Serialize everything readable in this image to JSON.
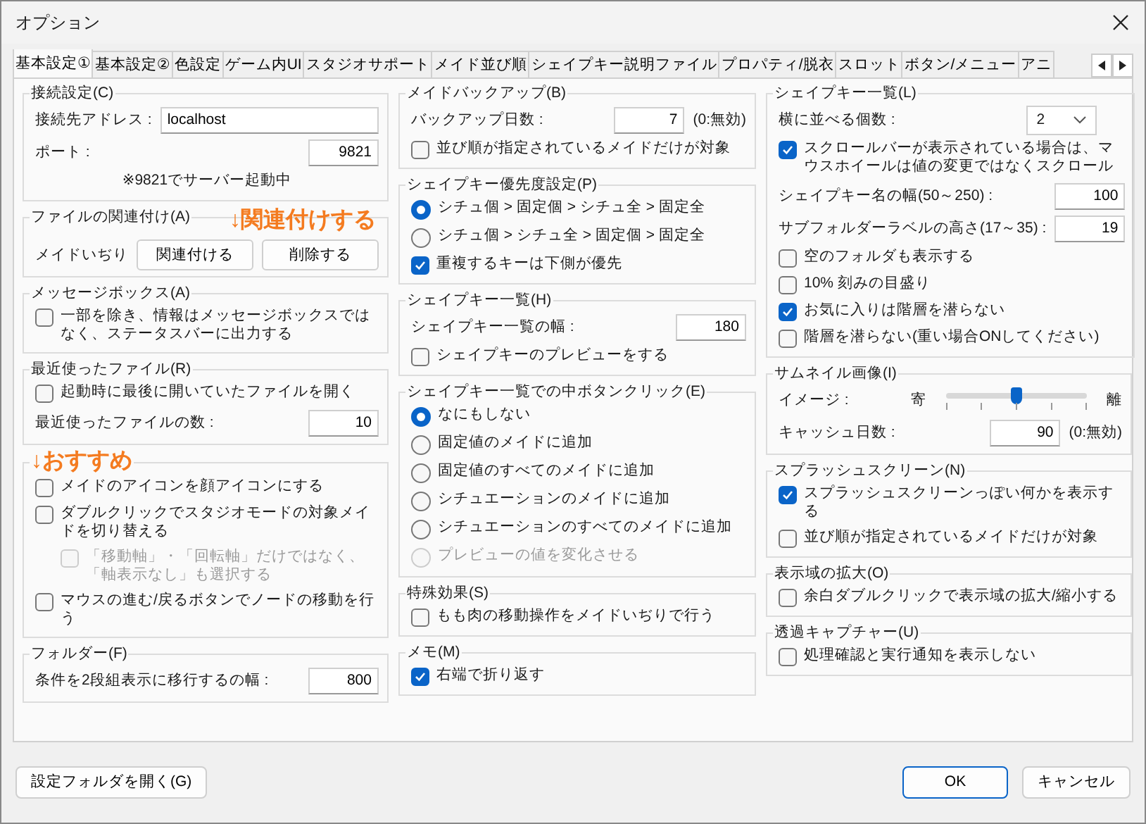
{
  "window": {
    "title": "オプション"
  },
  "tabs": [
    {
      "label": "基本設定①",
      "selected": true
    },
    {
      "label": "基本設定②",
      "selected": false
    },
    {
      "label": "色設定",
      "selected": false
    },
    {
      "label": "ゲーム内UI",
      "selected": false
    },
    {
      "label": "スタジオサポート",
      "selected": false
    },
    {
      "label": "メイド並び順",
      "selected": false
    },
    {
      "label": "シェイプキー説明ファイル",
      "selected": false
    },
    {
      "label": "プロパティ/脱衣",
      "selected": false
    },
    {
      "label": "スロット",
      "selected": false
    },
    {
      "label": "ボタン/メニュー",
      "selected": false
    },
    {
      "label": "アニ",
      "selected": false
    }
  ],
  "columns": [
    {
      "groups": [
        {
          "title": "接続設定(C)",
          "items": [
            {
              "kind": "text-field",
              "label": "接続先アドレス :",
              "value": "localhost"
            },
            {
              "kind": "number-field",
              "label": "ポート :",
              "value": "9821"
            },
            {
              "kind": "note",
              "text": "※9821でサーバー起動中"
            }
          ]
        },
        {
          "title": "ファイルの関連付け(A)",
          "annotation": "↓関連付けする",
          "items": [
            {
              "kind": "buttons",
              "label": "メイドいぢり",
              "buttons": [
                "関連付ける",
                "削除する"
              ]
            }
          ]
        },
        {
          "title": "メッセージボックス(A)",
          "items": [
            {
              "kind": "checkbox",
              "label": "一部を除き、情報はメッセージボックスではなく、ステータスバーに出力する",
              "checked": false,
              "disabled": false
            }
          ]
        },
        {
          "title": "最近使ったファイル(R)",
          "items": [
            {
              "kind": "checkbox",
              "label": "起動時に最後に開いていたファイルを開く",
              "checked": false,
              "disabled": false
            },
            {
              "kind": "number-field",
              "label": "最近使ったファイルの数 :",
              "value": "10"
            }
          ]
        },
        {
          "annotation": "↓おすすめ",
          "items": [
            {
              "kind": "checkbox",
              "label": "メイドのアイコンを顔アイコンにする",
              "checked": false,
              "disabled": false
            },
            {
              "kind": "checkbox",
              "label": "ダブルクリックでスタジオモードの対象メイドを切り替える",
              "checked": false,
              "disabled": false,
              "children": [
                {
                  "kind": "checkbox",
                  "label": "「移動軸」・「回転軸」だけではなく、「軸表示なし」も選択する",
                  "checked": false,
                  "disabled": true
                }
              ]
            },
            {
              "kind": "checkbox",
              "label": "マウスの進む/戻るボタンでノードの移動を行う",
              "checked": false,
              "disabled": false
            }
          ]
        },
        {
          "title": "フォルダー(F)",
          "items": [
            {
              "kind": "number-field",
              "label": "条件を2段組表示に移行するの幅 :",
              "value": "800"
            }
          ]
        }
      ]
    },
    {
      "groups": [
        {
          "title": "メイドバックアップ(B)",
          "items": [
            {
              "kind": "number-field",
              "label": "バックアップ日数 :",
              "value": "7",
              "suffix": "(0:無効)"
            },
            {
              "kind": "checkbox",
              "label": "並び順が指定されているメイドだけが対象",
              "checked": false,
              "disabled": false
            }
          ]
        },
        {
          "title": "シェイプキー優先度設定(P)",
          "items": [
            {
              "kind": "radio",
              "label": "シチュ個 > 固定個 > シチュ全 > 固定全",
              "selected": true,
              "disabled": false
            },
            {
              "kind": "radio",
              "label": "シチュ個 > シチュ全 > 固定個 > 固定全",
              "selected": false,
              "disabled": false
            },
            {
              "kind": "checkbox",
              "label": "重複するキーは下側が優先",
              "checked": true,
              "disabled": false
            }
          ]
        },
        {
          "title": "シェイプキー一覧(H)",
          "items": [
            {
              "kind": "number-field",
              "label": "シェイプキー一覧の幅 :",
              "value": "180"
            },
            {
              "kind": "checkbox",
              "label": "シェイプキーのプレビューをする",
              "checked": false,
              "disabled": false
            }
          ]
        },
        {
          "title": "シェイプキー一覧での中ボタンクリック(E)",
          "items": [
            {
              "kind": "radio",
              "label": "なにもしない",
              "selected": true,
              "disabled": false
            },
            {
              "kind": "radio",
              "label": "固定値のメイドに追加",
              "selected": false,
              "disabled": false
            },
            {
              "kind": "radio",
              "label": "固定値のすべてのメイドに追加",
              "selected": false,
              "disabled": false
            },
            {
              "kind": "radio",
              "label": "シチュエーションのメイドに追加",
              "selected": false,
              "disabled": false
            },
            {
              "kind": "radio",
              "label": "シチュエーションのすべてのメイドに追加",
              "selected": false,
              "disabled": false
            },
            {
              "kind": "radio",
              "label": "プレビューの値を変化させる",
              "selected": false,
              "disabled": true
            }
          ]
        },
        {
          "title": "特殊効果(S)",
          "items": [
            {
              "kind": "checkbox",
              "label": "もも肉の移動操作をメイドいぢりで行う",
              "checked": false,
              "disabled": false
            }
          ]
        },
        {
          "title": "メモ(M)",
          "items": [
            {
              "kind": "checkbox",
              "label": "右端で折り返す",
              "checked": true,
              "disabled": false
            }
          ]
        }
      ]
    },
    {
      "groups": [
        {
          "title": "シェイプキー一覧(L)",
          "items": [
            {
              "kind": "combo",
              "label": "横に並べる個数 :",
              "value": "2"
            },
            {
              "kind": "checkbox",
              "label": "スクロールバーが表示されている場合は、マウスホイールは値の変更ではなくスクロール",
              "checked": true,
              "disabled": false
            },
            {
              "kind": "number-field",
              "label": "シェイプキー名の幅(50～250) :",
              "value": "100"
            },
            {
              "kind": "number-field",
              "label": "サブフォルダーラベルの高さ(17～35) :",
              "value": "19"
            },
            {
              "kind": "checkbox",
              "label": "空のフォルダも表示する",
              "checked": false,
              "disabled": false
            },
            {
              "kind": "checkbox",
              "label": "10% 刻みの目盛り",
              "checked": false,
              "disabled": false
            },
            {
              "kind": "checkbox",
              "label": "お気に入りは階層を潜らない",
              "checked": true,
              "disabled": false
            },
            {
              "kind": "checkbox",
              "label": "階層を潜らない(重い場合ONしてください)",
              "checked": false,
              "disabled": false
            }
          ]
        },
        {
          "title": "サムネイル画像(I)",
          "items": [
            {
              "kind": "slider",
              "label": "イメージ :",
              "low": "寄",
              "high": "離",
              "level": 0.5
            },
            {
              "kind": "number-field",
              "label": "キャッシュ日数 :",
              "value": "90",
              "suffix": "(0:無効)"
            }
          ]
        },
        {
          "title": "スプラッシュスクリーン(N)",
          "items": [
            {
              "kind": "checkbox",
              "label": "スプラッシュスクリーンっぽい何かを表示する",
              "checked": true,
              "disabled": false
            },
            {
              "kind": "checkbox",
              "label": "並び順が指定されているメイドだけが対象",
              "checked": false,
              "disabled": false
            }
          ]
        },
        {
          "title": "表示域の拡大(O)",
          "items": [
            {
              "kind": "checkbox",
              "label": "余白ダブルクリックで表示域の拡大/縮小する",
              "checked": false,
              "disabled": false
            }
          ]
        },
        {
          "title": "透過キャプチャー(U)",
          "items": [
            {
              "kind": "checkbox",
              "label": "処理確認と実行通知を表示しない",
              "checked": false,
              "disabled": false
            }
          ]
        }
      ]
    }
  ],
  "footer": {
    "left_button": "設定フォルダを開く(G)",
    "buttons": [
      {
        "label": "OK",
        "kind": "default"
      },
      {
        "label": "キャンセル",
        "kind": "normal"
      }
    ]
  }
}
